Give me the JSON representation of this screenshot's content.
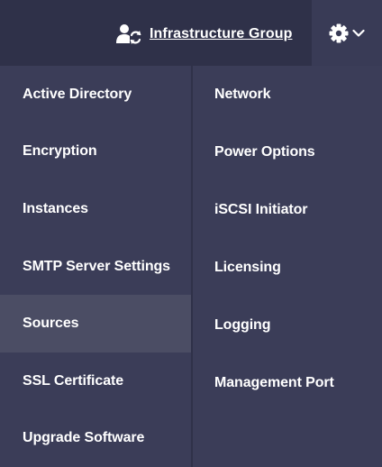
{
  "header": {
    "group_label": "Infrastructure Group",
    "group_icon": "user-sync-icon",
    "settings_icon": "gear-icon",
    "dropdown_icon": "chevron-down-icon"
  },
  "menu": {
    "left": [
      {
        "label": "Active Directory"
      },
      {
        "label": "Encryption"
      },
      {
        "label": "Instances"
      },
      {
        "label": "SMTP Server Settings"
      },
      {
        "label": "Sources",
        "active": true
      },
      {
        "label": "SSL Certificate"
      },
      {
        "label": "Upgrade Software"
      }
    ],
    "right": [
      {
        "label": "Network"
      },
      {
        "label": "Power Options"
      },
      {
        "label": "iSCSI Initiator"
      },
      {
        "label": "Licensing"
      },
      {
        "label": "Logging"
      },
      {
        "label": "Management Port"
      }
    ]
  },
  "colors": {
    "background": "#3b3d58",
    "header": "#2f3149",
    "active_item": "#4b4d64",
    "text": "#ffffff"
  }
}
